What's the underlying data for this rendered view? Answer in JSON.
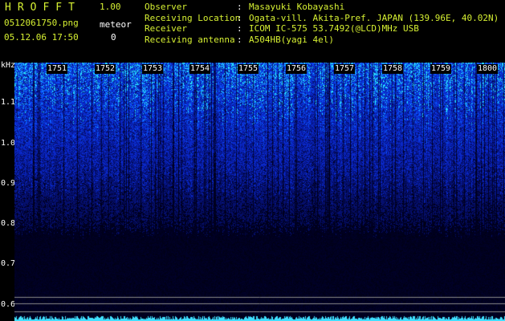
{
  "app": {
    "title": "HROFFT",
    "version": "1.00"
  },
  "file": {
    "name": "0512061750.png",
    "datetime": "05.12.06 17:50"
  },
  "meteor": {
    "label": "meteor",
    "count": "0"
  },
  "info": [
    {
      "key": "Observer",
      "value": "Masayuki Kobayashi"
    },
    {
      "key": "Receiving Location",
      "value": "Ogata-vill. Akita-Pref. JAPAN (139.96E, 40.02N)"
    },
    {
      "key": "Receiver",
      "value": "ICOM IC-575 53.7492(@LCD)MHz USB"
    },
    {
      "key": "Receiving antenna",
      "value": "A504HB(yagi 4el)"
    }
  ],
  "axis": {
    "unit": "kHz",
    "ticks": [
      "1.1",
      "1.0",
      "0.9",
      "0.8",
      "0.7",
      "0.6"
    ]
  },
  "minutes": [
    "1751",
    "1752",
    "1753",
    "1754",
    "1755",
    "1756",
    "1757",
    "1758",
    "1759",
    "1800"
  ],
  "colors": {
    "label_yellow": "#d6f032",
    "noise_blue": "#1030d0",
    "noise_cyan": "#40e0ff",
    "baseline_cyan": "#40e0ff"
  }
}
